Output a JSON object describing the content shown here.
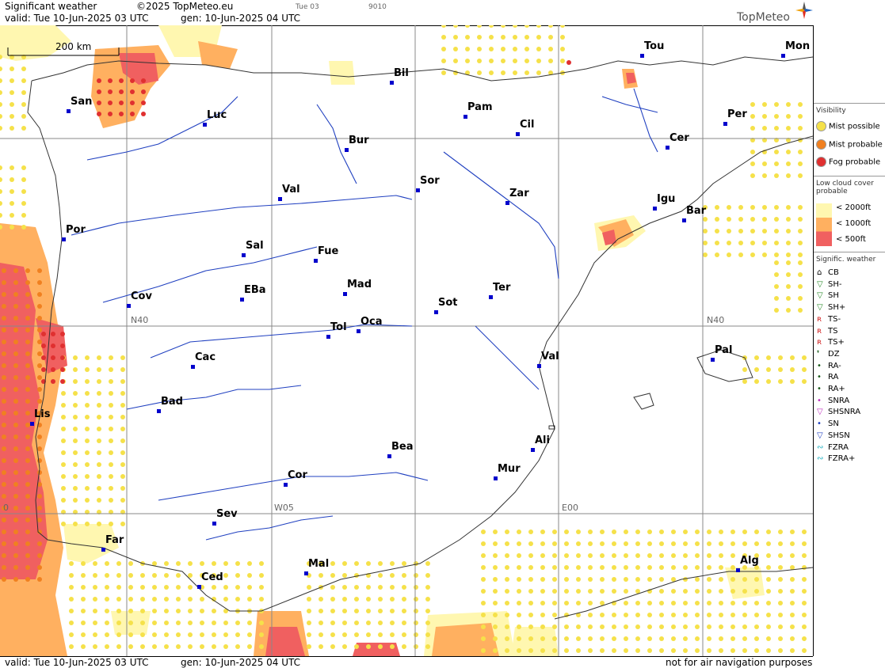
{
  "header": {
    "title": "Significant weather",
    "copyright": "©2025 TopMeteo.eu",
    "small_time": "Tue 03",
    "small_code": "9010",
    "valid": "valid:  Tue  10-Jun-2025  03 UTC",
    "gen": "gen: 10-Jun-2025 04 UTC",
    "brand": "TopMeteo"
  },
  "footer": {
    "valid": "valid:  Tue  10-Jun-2025  03 UTC",
    "gen": "gen: 10-Jun-2025 04 UTC",
    "disclaimer": "not for air navigation purposes"
  },
  "scale": {
    "label": "200 km"
  },
  "grid_labels": {
    "n40_west": "N40",
    "n40_east": "N40",
    "w05": "W05",
    "e00": "E00",
    "w10": "0"
  },
  "cities": [
    {
      "name": "San"
    },
    {
      "name": "Luc"
    },
    {
      "name": "Bil"
    },
    {
      "name": "Pam"
    },
    {
      "name": "Cil"
    },
    {
      "name": "Tou"
    },
    {
      "name": "Mon"
    },
    {
      "name": "Per"
    },
    {
      "name": "Cer"
    },
    {
      "name": "Bur"
    },
    {
      "name": "Val"
    },
    {
      "name": "Sor"
    },
    {
      "name": "Zar"
    },
    {
      "name": "Igu"
    },
    {
      "name": "Bar"
    },
    {
      "name": "Por"
    },
    {
      "name": "Sal"
    },
    {
      "name": "Fue"
    },
    {
      "name": "Mad"
    },
    {
      "name": "EBa"
    },
    {
      "name": "Cov"
    },
    {
      "name": "Ter"
    },
    {
      "name": "Sot"
    },
    {
      "name": "Tol"
    },
    {
      "name": "Oca"
    },
    {
      "name": "Cac"
    },
    {
      "name": "Val"
    },
    {
      "name": "Pal"
    },
    {
      "name": "Bad"
    },
    {
      "name": "Lis"
    },
    {
      "name": "Bea"
    },
    {
      "name": "Ali"
    },
    {
      "name": "Mur"
    },
    {
      "name": "Cor"
    },
    {
      "name": "Sev"
    },
    {
      "name": "Far"
    },
    {
      "name": "Ced"
    },
    {
      "name": "Mal"
    },
    {
      "name": "Alg"
    }
  ],
  "legend": {
    "visibility_title": "Visibility",
    "mist_possible": "Mist possible",
    "mist_probable": "Mist probable",
    "fog_probable": "Fog probable",
    "lowcloud_title": "Low cloud cover probable",
    "lc_2000": "< 2000ft",
    "lc_1000": "< 1000ft",
    "lc_500": "<   500ft",
    "sigwx_title": "Signific. weather",
    "sigwx_items": [
      "CB",
      "SH-",
      "SH",
      "SH+",
      "TS-",
      "TS",
      "TS+",
      "DZ",
      "RA-",
      "RA",
      "RA+",
      "SNRA",
      "SHSNRA",
      "SN",
      "SHSN",
      "FZRA",
      "FZRA+"
    ]
  },
  "colors": {
    "light_yellow": "#fff7b0",
    "orange": "#ffb060",
    "red": "#f06060",
    "mist_dot": "#f5e14a",
    "fog_dot": "#e03030",
    "city": "#0000cc",
    "river": "#2040c0",
    "grid": "#888888"
  }
}
